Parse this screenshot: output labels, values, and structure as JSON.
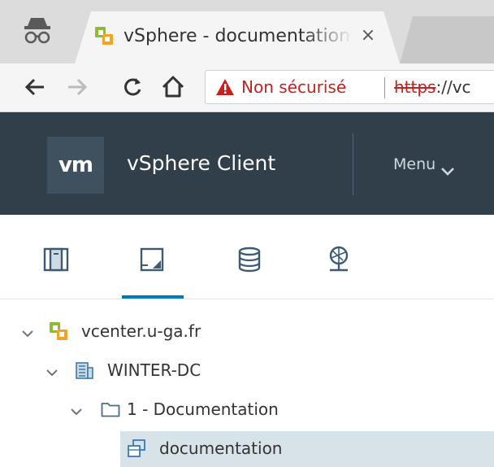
{
  "browser": {
    "tab_title": "vSphere - documentation",
    "tab_close": "×",
    "security_label": "Non sécurisé",
    "url_scheme": "https",
    "url_rest": "://vc"
  },
  "header": {
    "logo": "vm",
    "app_name": "vSphere Client",
    "menu_label": "Menu"
  },
  "nav_tabs": [
    {
      "name": "hosts-and-clusters",
      "active": false
    },
    {
      "name": "vms-and-templates",
      "active": true
    },
    {
      "name": "storage",
      "active": false
    },
    {
      "name": "networking",
      "active": false
    }
  ],
  "tree": {
    "items": [
      {
        "label": "vcenter.u-ga.fr",
        "icon": "vcenter-icon",
        "expanded": true
      },
      {
        "label": "WINTER-DC",
        "icon": "datacenter-icon",
        "expanded": true
      },
      {
        "label": "1 - Documentation",
        "icon": "folder-icon",
        "expanded": true
      },
      {
        "label": "documentation",
        "icon": "vm-icon",
        "selected": true
      }
    ]
  },
  "colors": {
    "header_bg": "#313f4b",
    "accent": "#0079b8",
    "selected_row": "#d8e3e9",
    "warning_red": "#c5221f"
  }
}
